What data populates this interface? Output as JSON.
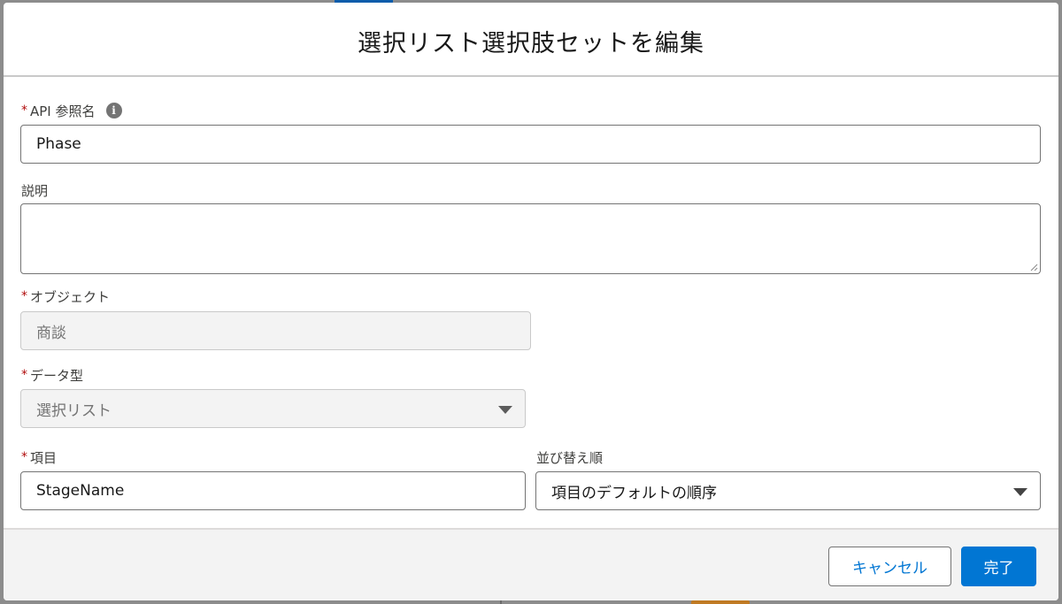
{
  "modal": {
    "title": "選択リスト選択肢セットを編集"
  },
  "form": {
    "api_name": {
      "required_mark": "*",
      "label": "API 参照名",
      "info_icon": "i",
      "value": "Phase"
    },
    "description": {
      "label": "説明",
      "value": ""
    },
    "object": {
      "required_mark": "*",
      "label": "オブジェクト",
      "value": "商談"
    },
    "data_type": {
      "required_mark": "*",
      "label": "データ型",
      "value": "選択リスト"
    },
    "field": {
      "required_mark": "*",
      "label": "項目",
      "value": "StageName"
    },
    "sort_order": {
      "label": "並び替え順",
      "value": "項目のデフォルトの順序"
    }
  },
  "footer": {
    "cancel_label": "キャンセル",
    "done_label": "完了"
  },
  "colors": {
    "brand": "#0176d3",
    "required": "#b00c0c",
    "disabled_bg": "#f3f3f3"
  },
  "icons": {
    "info": "info-icon",
    "dropdown": "chevron-down-icon",
    "resize": "resize-grip-icon"
  }
}
